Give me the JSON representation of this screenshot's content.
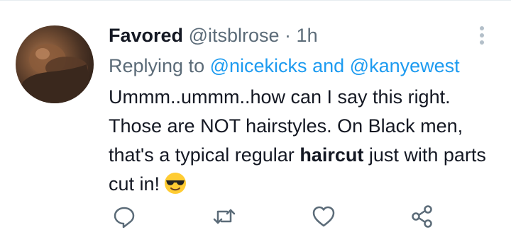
{
  "tweet": {
    "display_name": "Favored",
    "handle": "@itsblrose",
    "separator": "·",
    "time": "1h",
    "replying_prefix": "Replying to",
    "mention_1": "@nicekicks",
    "mention_and": "and",
    "mention_2": "@kanyewest",
    "text_part_1": "Ummm..ummm..how can I say this right. Those are NOT hairstyles. On Black men, that's a typical regular",
    "text_bold": "haircut",
    "text_part_2": "just with parts cut in!",
    "emoji": "smiling-face-with-sunglasses"
  },
  "icons": {
    "more": "more-vertical-icon",
    "reply": "reply-icon",
    "retweet": "retweet-icon",
    "like": "heart-icon",
    "share": "share-icon"
  },
  "colors": {
    "text": "#141823",
    "secondary": "#5b6b78",
    "link": "#1d9bf0",
    "divider": "#e6ecf0"
  }
}
